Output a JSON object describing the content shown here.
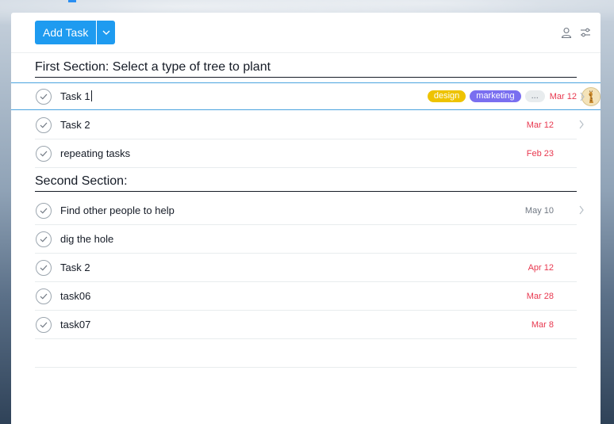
{
  "toolbar": {
    "add_task_label": "Add Task",
    "icons": [
      "chevron-down-icon",
      "person-icon",
      "filter-sliders-icon"
    ]
  },
  "sections": [
    {
      "title": "First Section: Select a type of tree to plant",
      "tasks": [
        {
          "name": "Task 1",
          "due": "Mar 12",
          "due_color": "#e8384f",
          "tags": [
            "design",
            "marketing",
            "..."
          ],
          "assignee": "giraffe-avatar",
          "selected": true,
          "editing": true
        },
        {
          "name": "Task 2",
          "due": "Mar 12",
          "due_color": "#e8384f"
        },
        {
          "name": "repeating tasks",
          "due": "Feb 23",
          "due_color": "#e8384f"
        }
      ]
    },
    {
      "title": "Second Section:",
      "tasks": [
        {
          "name": "Find other people to help",
          "due": "May 10",
          "due_color": "#6f7782"
        },
        {
          "name": "dig the hole",
          "due": ""
        },
        {
          "name": "Task 2",
          "due": "Apr 12",
          "due_color": "#e8384f"
        },
        {
          "name": "task06",
          "due": "Mar 28",
          "due_color": "#e8384f"
        },
        {
          "name": "task07",
          "due": "Mar 8",
          "due_color": "#e8384f"
        }
      ]
    }
  ],
  "colors": {
    "accent": "#1e9bf0",
    "tag_design": "#eec300",
    "tag_marketing": "#7a6ff0",
    "due_overdue": "#e8384f"
  }
}
